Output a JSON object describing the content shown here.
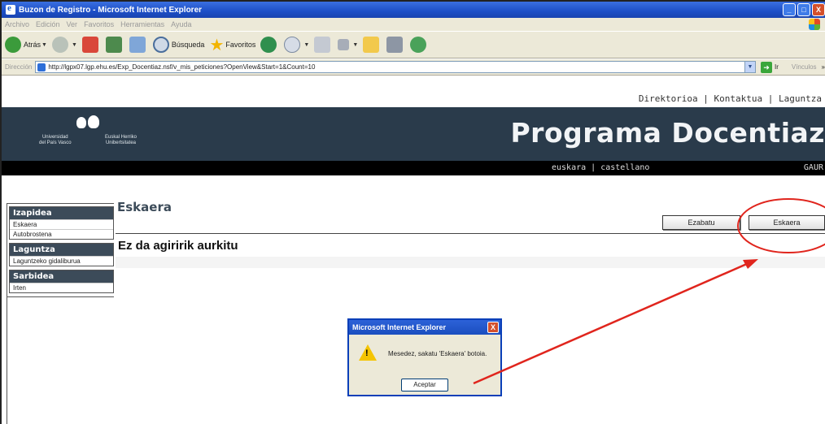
{
  "window": {
    "title": "Buzon de Registro - Microsoft Internet Explorer",
    "buttons": [
      "_",
      "□",
      "X"
    ]
  },
  "menu": [
    "Archivo",
    "Edición",
    "Ver",
    "Favoritos",
    "Herramientas",
    "Ayuda"
  ],
  "toolbar": {
    "back": "Atrás",
    "search": "Búsqueda",
    "favorites": "Favoritos"
  },
  "address": {
    "label": "Dirección",
    "url": "http://lgpx07.lgp.ehu.es/Exp_Docentiaz.nsf/v_mis_peticiones?OpenView&Start=1&Count=10",
    "go": "Ir",
    "links": "Vínculos"
  },
  "header": {
    "utility_links": "Direktorioa | Kontaktua | Laguntza",
    "title": "Programa Docentiaz",
    "logo_left": [
      "Universidad",
      "del País Vasco"
    ],
    "logo_right": [
      "Euskal Herriko",
      "Unibertsitatea"
    ],
    "languages": "euskara | castellano",
    "right_label": "GAUR"
  },
  "sidebar": [
    {
      "heading": "Izapidea",
      "items": [
        "Eskaera",
        "Autobrostena"
      ]
    },
    {
      "heading": "Laguntza",
      "items": [
        "Laguntzeko gidaliburua"
      ]
    },
    {
      "heading": "Sarbidea",
      "items": [
        "Irten"
      ]
    }
  ],
  "main": {
    "title": "Eskaera",
    "delete_button": "Ezabatu",
    "request_button": "Eskaera",
    "empty_message": "Ez da agiririk aurkitu"
  },
  "dialog": {
    "title": "Microsoft Internet Explorer",
    "message": "Mesedez, sakatu 'Eskaera' botoia.",
    "ok": "Aceptar"
  },
  "colors": {
    "banner": "#2a3b4b",
    "annotation": "#e0251d",
    "sidebar_head": "#3c4b59"
  }
}
